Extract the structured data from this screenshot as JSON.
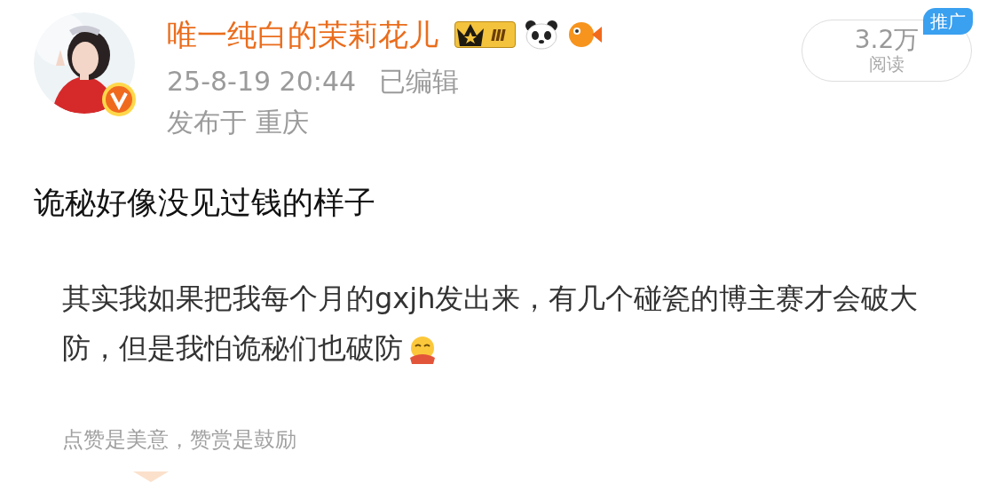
{
  "post": {
    "author": "唯一纯白的茉莉花儿",
    "level_badge": "Ⅲ",
    "verified": true,
    "time": "25-8-19 20:44",
    "edited": "已编辑",
    "location": "发布于 重庆",
    "text": "诡秘好像没见过钱的样子"
  },
  "read_count": {
    "count": "3.2万",
    "label": "阅读",
    "promo": "推广"
  },
  "quote": {
    "text": "其实我如果把我每个月的gxjh发出来，有几个碰瓷的博主赛才会破大防，但是我怕诡秘们也破防"
  },
  "reward_prompt": "点赞是美意，赞赏是鼓励"
}
